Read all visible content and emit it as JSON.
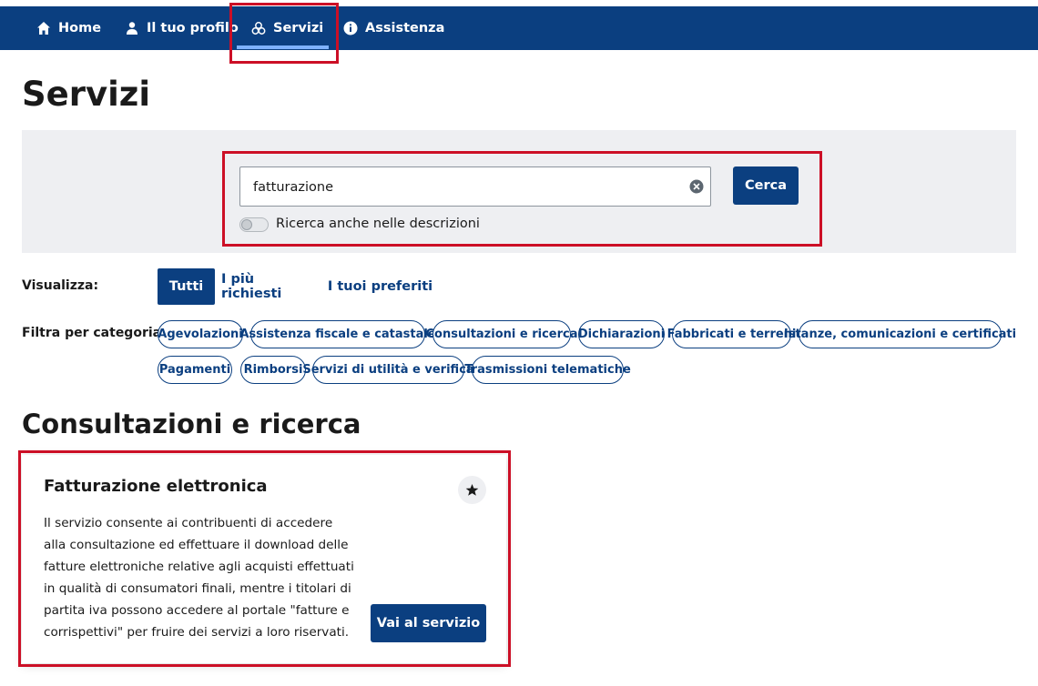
{
  "nav": {
    "items": [
      {
        "label": "Home",
        "icon": "home-icon"
      },
      {
        "label": "Il tuo profilo",
        "icon": "user-icon"
      },
      {
        "label": "Servizi",
        "icon": "services-icon",
        "active": true
      },
      {
        "label": "Assistenza",
        "icon": "info-icon"
      }
    ]
  },
  "page": {
    "title": "Servizi"
  },
  "search": {
    "value": "fatturazione",
    "button_label": "Cerca",
    "toggle_label": "Ricerca anche nelle descrizioni",
    "toggle_on": false
  },
  "view": {
    "label": "Visualizza:",
    "tabs": [
      "Tutti",
      "I più richiesti",
      "I tuoi preferiti"
    ],
    "active_index": 0
  },
  "filter": {
    "label": "Filtra per categoria:",
    "categories": [
      "Agevolazioni",
      "Assistenza fiscale e catastale",
      "Consultazioni e ricerca",
      "Dichiarazioni",
      "Fabbricati e terreni",
      "Istanze, comunicazioni e certificati",
      "Pagamenti",
      "Rimborsi",
      "Servizi di utilità e verifica",
      "Trasmissioni telematiche"
    ]
  },
  "section": {
    "title": "Consultazioni e ricerca"
  },
  "card": {
    "title": "Fatturazione elettronica",
    "description": "Il servizio consente ai contribuenti di accedere alla consultazione ed effettuare il download delle fatture elettroniche relative agli acquisti effettuati in qualità di consumatori finali, mentre i titolari di partita iva possono accedere al portale \"fatture e corrispettivi\" per fruire dei servizi a loro riservati.",
    "button_label": "Vai al servizio",
    "star_icon": "star-icon"
  },
  "colors": {
    "primary": "#0b3f80",
    "highlight": "#cc0f26",
    "panel": "#eeeff2"
  }
}
